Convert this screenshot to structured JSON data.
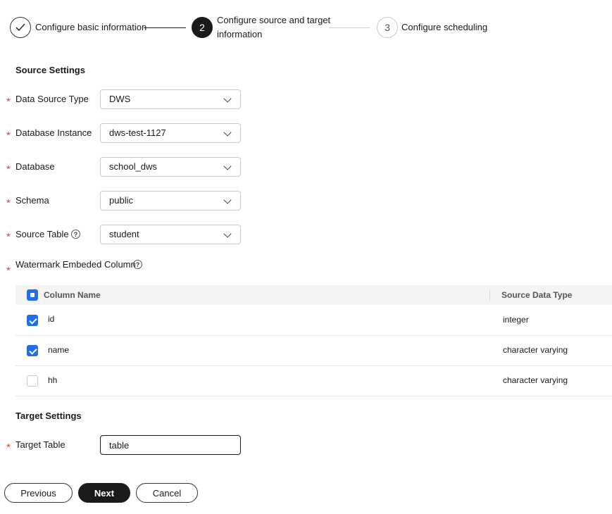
{
  "stepper": {
    "steps": [
      {
        "label": "Configure basic information",
        "state": "done"
      },
      {
        "label_line1": "Configure source and target",
        "label_line2": "information",
        "number": "2",
        "state": "active"
      },
      {
        "label": "Configure scheduling",
        "number": "3",
        "state": "todo"
      }
    ]
  },
  "source_settings": {
    "title": "Source Settings",
    "data_source_type": {
      "label": "Data Source Type",
      "value": "DWS"
    },
    "database_instance": {
      "label": "Database Instance",
      "value": "dws-test-1127"
    },
    "database": {
      "label": "Database",
      "value": "school_dws"
    },
    "schema": {
      "label": "Schema",
      "value": "public"
    },
    "source_table": {
      "label": "Source Table",
      "value": "student"
    },
    "watermark_column": {
      "label": "Watermark Embeded Column"
    }
  },
  "columns_table": {
    "headers": {
      "column_name": "Column Name",
      "source_data_type": "Source Data Type"
    },
    "rows": [
      {
        "name": "id",
        "type": "integer",
        "checked": true
      },
      {
        "name": "name",
        "type": "character varying",
        "checked": true
      },
      {
        "name": "hh",
        "type": "character varying",
        "checked": false
      }
    ]
  },
  "target_settings": {
    "title": "Target Settings",
    "target_table": {
      "label": "Target Table",
      "value": "table"
    }
  },
  "actions": {
    "previous": "Previous",
    "next": "Next",
    "cancel": "Cancel"
  },
  "icons": {
    "help": "?",
    "required": "*"
  },
  "colors": {
    "accent": "#1f6feb",
    "required": "#e0443e",
    "primary_button": "#1a1a1a"
  }
}
